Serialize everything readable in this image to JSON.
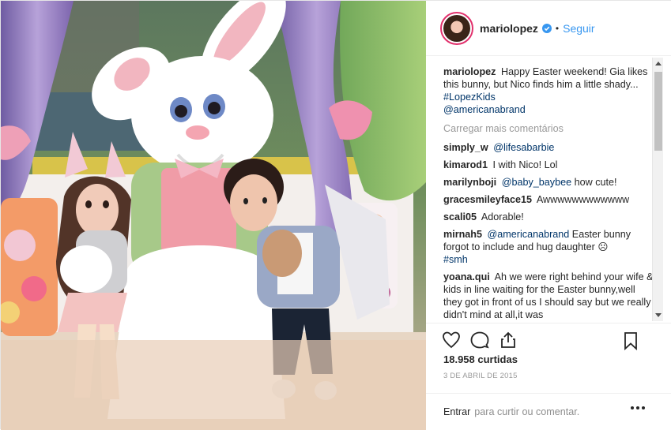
{
  "post": {
    "author": "mariolopez",
    "follow_label": "Seguir",
    "dot": "•",
    "photo_alt": "Easter bunny photo",
    "caption": {
      "user": "mariolopez",
      "text": "Happy Easter weekend! Gia likes this bunny, but Nico finds him a little shady...",
      "hashtag": "#LopezKids",
      "mention": "@americanabrand"
    },
    "load_more": "Carregar mais comentários",
    "comments": [
      {
        "user": "simply_w",
        "mention": "@lifesabarbie",
        "text": ""
      },
      {
        "user": "kimarod1",
        "mention": "",
        "text": "I with Nico! Lol"
      },
      {
        "user": "marilynboji",
        "mention": "@baby_baybee",
        "text": "how cute!"
      },
      {
        "user": "gracesmileyface15",
        "mention": "",
        "text": "Awwwwwwwwwwww"
      },
      {
        "user": "scali05",
        "mention": "",
        "text": "Adorable!"
      },
      {
        "user": "mirnah5",
        "mention": "@americanabrand",
        "text": "Easter bunny forgot to include and hug daughter",
        "emoji": "☹",
        "hashtag": "#smh"
      },
      {
        "user": "yoana.qui",
        "mention": "",
        "text": "Ah we were right behind your wife & kids in line waiting for the Easter bunny,well they got in front of us I should say but we really didn't mind at all,it was"
      }
    ],
    "likes": "18.958 curtidas",
    "date": "3 DE ABRIL DE 2015",
    "comment_prompt_enter": "Entrar",
    "comment_prompt_text": "para curtir ou comentar."
  },
  "icons": {
    "like": "heart-icon",
    "comment": "comment-icon",
    "share": "share-icon",
    "save": "bookmark-icon",
    "more": "more-options-icon",
    "verified": "verified-badge-icon"
  },
  "colors": {
    "link": "#3897f0",
    "mention": "#003569",
    "muted": "#999999"
  }
}
